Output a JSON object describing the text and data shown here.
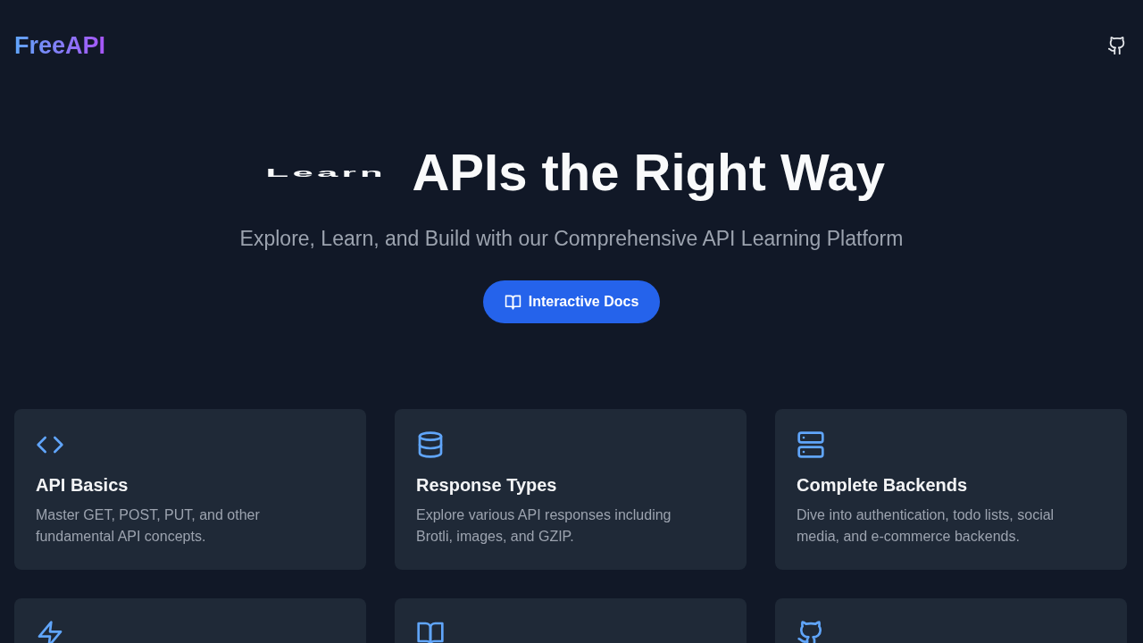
{
  "header": {
    "logo": "FreeAPI"
  },
  "hero": {
    "title_lead": "Learn",
    "title": "APIs the Right Way",
    "subtitle": "Explore, Learn, and Build with our Comprehensive API Learning Platform",
    "button": "Interactive Docs"
  },
  "features": [
    {
      "kind": "code",
      "title": "API Basics",
      "description": "Master GET, POST, PUT, and other fundamental API concepts."
    },
    {
      "kind": "database",
      "title": "Response Types",
      "description": "Explore various API responses including Brotli, images, and GZIP."
    },
    {
      "kind": "server",
      "title": "Complete Backends",
      "description": "Dive into authentication, todo lists, social media, and e-commerce backends."
    },
    {
      "kind": "zap"
    },
    {
      "kind": "book"
    },
    {
      "kind": "github"
    }
  ]
}
